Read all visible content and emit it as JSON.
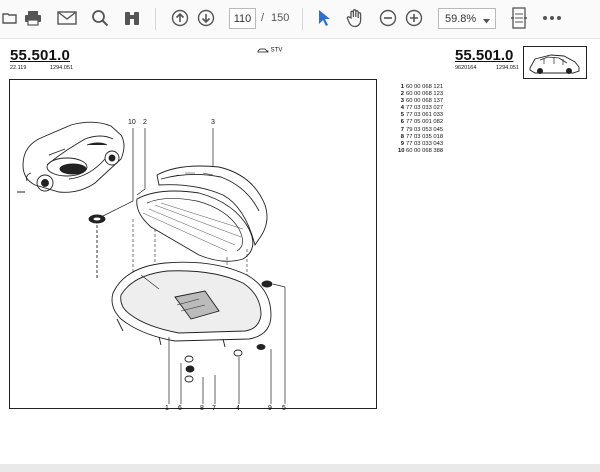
{
  "toolbar": {
    "icons": [
      "folder-open-icon",
      "print-icon",
      "email-icon",
      "search-icon",
      "binoculars-icon",
      "page-up-icon",
      "page-down-icon",
      "select-arrow-icon",
      "hand-tool-icon",
      "zoom-out-icon",
      "zoom-in-icon",
      "fit-page-icon",
      "more-icon"
    ],
    "current_page": "110",
    "page_separator": "/",
    "total_pages": "150",
    "zoom": "59.8%",
    "accent": "#2d6fd6"
  },
  "page": {
    "header_left_number": "55.501.0",
    "header_left_ref1": "22.119",
    "header_left_ref2": "1294.051",
    "stv_label": "STV",
    "header_right_number": "55.501.0",
    "header_right_ref1": "9620164",
    "header_right_ref2": "1294.051"
  },
  "parts": [
    {
      "no": "1",
      "ref": "60 00 068 121"
    },
    {
      "no": "2",
      "ref": "60 00 068 123"
    },
    {
      "no": "3",
      "ref": "60 00 068 137"
    },
    {
      "no": "4",
      "ref": "77 03 033 027"
    },
    {
      "no": "5",
      "ref": "77 03 061 033"
    },
    {
      "no": "6",
      "ref": "77 05 001 082"
    },
    {
      "no": "7",
      "ref": "79 03 053 045"
    },
    {
      "no": "8",
      "ref": "77 03 035 018"
    },
    {
      "no": "9",
      "ref": "77 03 033 043"
    },
    {
      "no": "10",
      "ref": "60 00 068 388"
    }
  ],
  "callouts_top": [
    "10",
    "2",
    "3"
  ],
  "callouts_bottom": [
    "1",
    "6",
    "8",
    "7",
    "4",
    "9",
    "5"
  ]
}
